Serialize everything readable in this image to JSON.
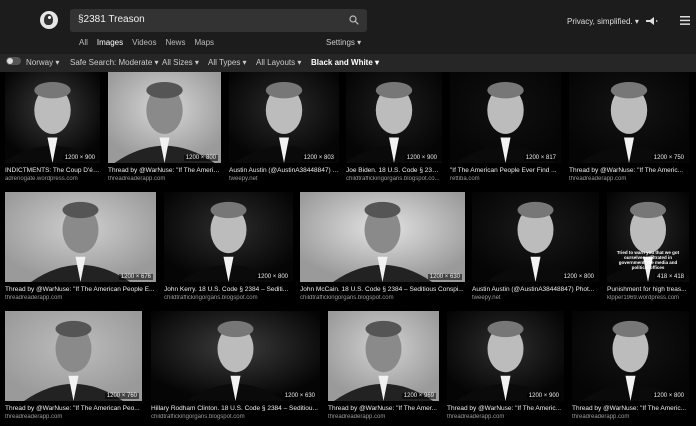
{
  "search": {
    "query": "§2381 Treason"
  },
  "tabs": [
    "All",
    "Images",
    "Videos",
    "News",
    "Maps"
  ],
  "settings_label": "Settings",
  "privacy_label": "Privacy, simplified.",
  "filters": {
    "region": "Norway",
    "safe_search": "Safe Search: Moderate",
    "sizes": "All Sizes",
    "types": "All Types",
    "layouts": "All Layouts",
    "color": "Black and White"
  },
  "tiles": [
    {
      "title": "INDICTMENTS: The Coup D'ét...",
      "url": "adrenogate.wordpress.com",
      "dim": "1200 × 900"
    },
    {
      "title": "Thread by @WarNuse: \"If The Americ...",
      "url": "threadreaderapp.com",
      "dim": "1200 × 800"
    },
    {
      "title": "Austin Austin (@AustinA38448847) | ...",
      "url": "tweepy.net",
      "dim": "1200 × 803"
    },
    {
      "title": "Joe Biden. 18 U.S. Code § 2384 ...",
      "url": "childtraffickingorgans.blogspot.co...",
      "dim": "1200 × 900"
    },
    {
      "title": "\"If The American People Ever Find ...",
      "url": "rettiba.com",
      "dim": "1200 × 817"
    },
    {
      "title": "Thread by @WarNuse: \"If The Americ...",
      "url": "threadreaderapp.com",
      "dim": "1200 × 750"
    },
    {
      "title": "Thread by @WarNuse: \"If The American People E...",
      "url": "threadreaderapp.com",
      "dim": "1200 × 676"
    },
    {
      "title": "John Kerry. 18 U.S. Code § 2384 – Sediti...",
      "url": "childtraffickingorgans.blogspot.com",
      "dim": "1200 × 800"
    },
    {
      "title": "John McCain. 18 U.S. Code § 2384 – Seditious Conspi...",
      "url": "childtraffickingorgans.blogspot.com",
      "dim": "1200 × 630"
    },
    {
      "title": "Austin Austin (@AustinA38448847) Phot...",
      "url": "tweepy.net",
      "dim": "1200 × 800"
    },
    {
      "title": "Punishment for high treas...",
      "url": "klpper1969.wordpress.com",
      "dim": "418 × 418",
      "meme": "Tried to warn you that we got ourselves infiltrated in government, the media and political offices"
    },
    {
      "title": "Thread by @WarNuse: \"If The American Peo...",
      "url": "threadreaderapp.com",
      "dim": "1200 × 760"
    },
    {
      "title": "Hillary Rodham Clinton. 18 U.S. Code § 2384 – Seditiou...",
      "url": "childtraffickingorgans.blogspot.com",
      "dim": "1200 × 630"
    },
    {
      "title": "Thread by @WarNuse: \"If The Amer...",
      "url": "threadreaderapp.com",
      "dim": "1200 × 969"
    },
    {
      "title": "Thread by @WarNuse: \"If The Americ...",
      "url": "threadreaderapp.com",
      "dim": "1200 × 900"
    },
    {
      "title": "Thread by @WarNuse: \"If The Americ...",
      "url": "threadreaderapp.com",
      "dim": "1200 × 800"
    }
  ]
}
